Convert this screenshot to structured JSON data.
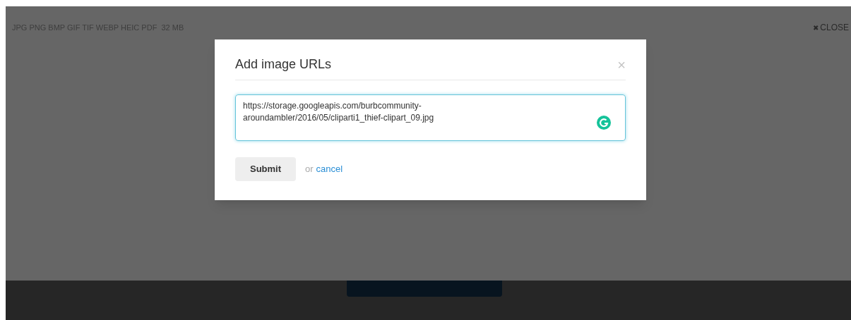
{
  "formats": "JPG PNG BMP GIF TIF WEBP HEIC PDF  32 MB",
  "close_link": {
    "icon": "✖",
    "label": "CLOSE"
  },
  "dialog": {
    "title": "Add image URLs",
    "close": "×",
    "url_field": {
      "value": "https://storage.googleapis.com/burbcommunity-aroundambler/2016/05/cliparti1_thief-clipart_09.jpg"
    },
    "submit": "Submit",
    "or": "or",
    "cancel": "cancel"
  }
}
